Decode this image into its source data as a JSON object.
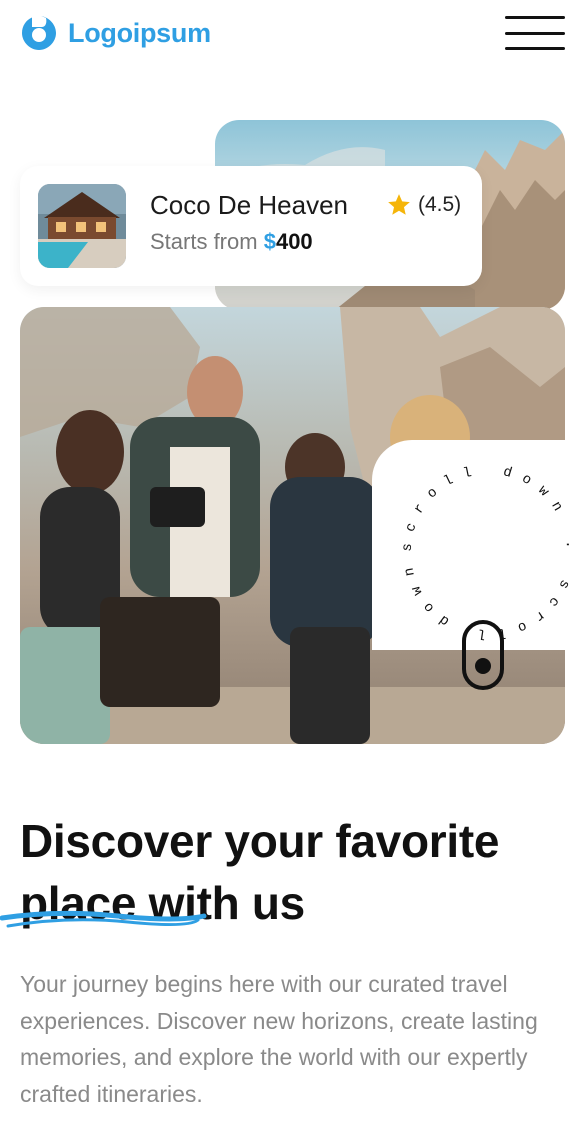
{
  "header": {
    "logo_text": "Logoipsum",
    "brand_color": "#2f9fe3",
    "menu_icon": "hamburger-menu-icon"
  },
  "card": {
    "title": "Coco De Heaven",
    "rating": "(4.5)",
    "subtitle_prefix": "Starts from",
    "currency": "$",
    "price": "400",
    "thumb_icon": "hotel-photo"
  },
  "scroll_badge": {
    "text": "scroll down . scroll down ."
  },
  "hero": {
    "headline_line1": "Discover your favorite",
    "headline_line2": "place with us",
    "body": "Your journey begins here with our curated travel experiences. Discover new horizons, create lasting memories, and explore the world with our expertly crafted itineraries."
  }
}
